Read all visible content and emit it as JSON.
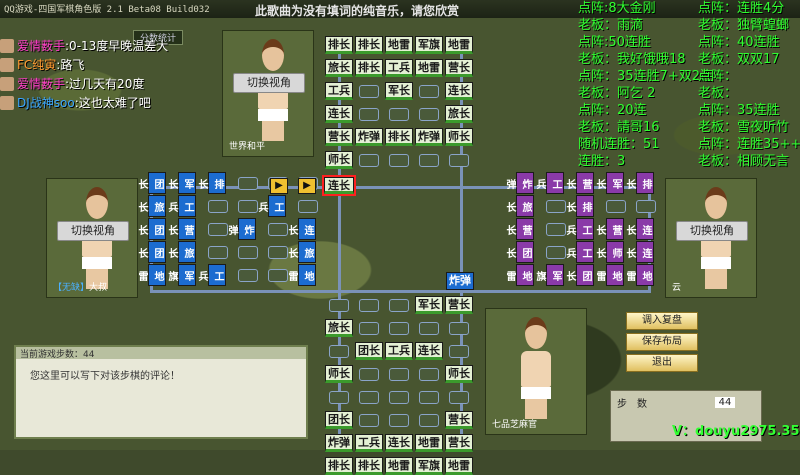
{
  "window": {
    "title": "QQ游戏-四国军棋角色版 2.1 Beta08 Build032",
    "banner": "此歌曲为没有填词的纯音乐，请您欣赏"
  },
  "chat": [
    {
      "name": "爱情薮手",
      "text": ":0-13度早晚温差大",
      "color": "pink"
    },
    {
      "name": "FC纯寅",
      "text": ":路飞",
      "color": "orange"
    },
    {
      "name": "爱情薮手",
      "text": ":过几天有20度",
      "color": "pink"
    },
    {
      "name": "DJ战神soo",
      "text": ":这也太难了吧",
      "color": "blue"
    }
  ],
  "stats_tab": "分数统计",
  "stats_left": [
    "点阵:8大金刚",
    "老板：雨滴",
    "点阵:50连胜",
    "老板：我好饿哦18",
    "点阵：35连胜7+双2连",
    "老板：阿乞 2",
    "点阵：20连",
    "老板：請哥16",
    "随机连胜：51",
    "连胜：3"
  ],
  "stats_right": [
    "点阵：连胜4分",
    "老板：独臂蝗螂",
    "点阵：40连胜",
    "老板：双双17",
    "点阵：",
    "老板：",
    "点阵：35连胜",
    "老板：雪夜听竹",
    "点阵：连胜35++",
    "老板：相顾无言"
  ],
  "players": {
    "top": {
      "view_label": "切换视角",
      "name_prefix": "",
      "name": "世界和平"
    },
    "left": {
      "view_label": "切换视角",
      "name_prefix": "【无缺】",
      "name": "大叔"
    },
    "right": {
      "view_label": "切换视角",
      "name_prefix": "",
      "name": "云"
    },
    "bottom": {
      "name": "七品芝麻官"
    }
  },
  "board": {
    "top_rows": [
      [
        "排长",
        "排长",
        "地雷",
        "军旗",
        "地雷"
      ],
      [
        "旅长",
        "排长",
        "工兵",
        "地雷",
        "营长"
      ],
      [
        "工兵",
        "",
        "军长",
        "",
        "连长"
      ],
      [
        "连长",
        "",
        "",
        "",
        "旅长"
      ],
      [
        "营长",
        "炸弹",
        "排长",
        "炸弹",
        "师长"
      ],
      [
        "师长",
        "",
        "",
        "",
        ""
      ]
    ],
    "bottom_rows": [
      [
        "",
        "",
        "",
        "军长",
        "营长"
      ],
      [
        "旅长",
        "",
        "",
        "",
        ""
      ],
      [
        "",
        "团长",
        "工兵",
        "连长",
        ""
      ],
      [
        "师长",
        "",
        "",
        "",
        "师长"
      ],
      [
        "",
        "",
        "",
        "",
        ""
      ],
      [
        "团长",
        "",
        "",
        "",
        "营长"
      ],
      [
        "炸弹",
        "工兵",
        "连长",
        "地雷",
        "营长"
      ],
      [
        "排长",
        "排长",
        "地雷",
        "军旗",
        "地雷"
      ]
    ],
    "left_cols": [
      [
        "团长",
        "旅长",
        "团长",
        "团长",
        "地雷"
      ],
      [
        "军长",
        "工兵",
        "营长",
        "旅长",
        "军旗"
      ],
      [
        "排长",
        "",
        "",
        "",
        "工兵"
      ],
      [
        "",
        "",
        "炸弹",
        "",
        ""
      ],
      [
        "",
        "工兵",
        "",
        "",
        ""
      ],
      [
        "",
        "",
        "连长",
        "旅长",
        "地雷"
      ]
    ],
    "right_cols": [
      [
        "炸弹",
        "旅长",
        "营长",
        "团长",
        "地雷"
      ],
      [
        "工兵",
        "",
        "",
        "",
        "军旗"
      ],
      [
        "营长",
        "排长",
        "工兵",
        "工兵",
        "团长"
      ],
      [
        "军长",
        "",
        "营长",
        "师长",
        "地雷"
      ],
      [
        "排长",
        "",
        "连长",
        "连长",
        "地雷"
      ]
    ],
    "center_piece": "连长",
    "center_right_piece": "炸弹"
  },
  "comment": {
    "header": "当前游戏步数：44",
    "placeholder": "您这里可以写下对该步棋的评论！"
  },
  "buttons": {
    "load_replay": "调入复盘",
    "save_layout": "保存布局",
    "exit": "退出"
  },
  "step": {
    "label": "步　数",
    "value": "44"
  },
  "watermark": "V：douyu2975.35",
  "colors": {
    "stats_green": "#30ff30",
    "piece_blue": "#1c6cd0",
    "piece_purple": "#8a3aa8",
    "piece_green_edge": "#3b9a2c",
    "selected": "#ff2020"
  }
}
